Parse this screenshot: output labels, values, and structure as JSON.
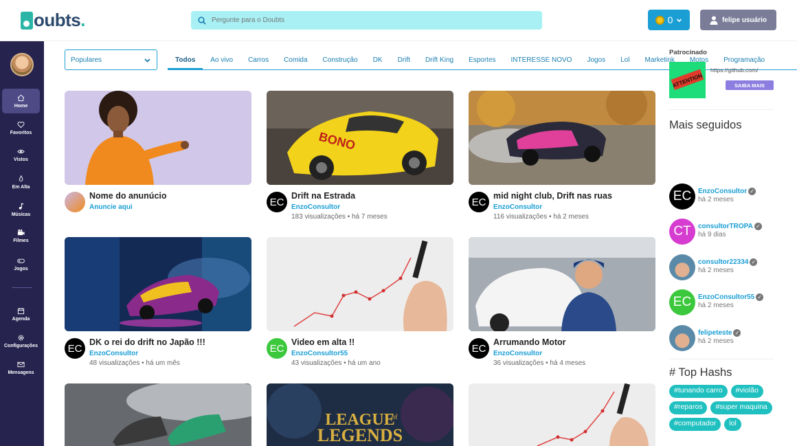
{
  "header": {
    "logo_text": "oubts",
    "logo_dot": ".",
    "search_placeholder": "Pergunte para o Doubts",
    "coins": "0",
    "user_name": "felipe usuário"
  },
  "sidebar": {
    "items": [
      {
        "label": "Home",
        "icon": "home-icon"
      },
      {
        "label": "Favoritos",
        "icon": "heart-icon"
      },
      {
        "label": "Vistos",
        "icon": "eye-icon"
      },
      {
        "label": "Em Alta",
        "icon": "flame-icon"
      },
      {
        "label": "Músicas",
        "icon": "music-icon"
      },
      {
        "label": "Filmes",
        "icon": "film-icon"
      },
      {
        "label": "Jogos",
        "icon": "gamepad-icon"
      },
      {
        "label": "Agenda",
        "icon": "calendar-icon"
      },
      {
        "label": "Configurações",
        "icon": "gear-icon"
      },
      {
        "label": "Mensagens",
        "icon": "mail-icon"
      }
    ]
  },
  "filter": {
    "selected": "Populares"
  },
  "tabs": [
    "Todos",
    "Ao vivo",
    "Carros",
    "Comida",
    "Construção",
    "DK",
    "Drift",
    "Drift King",
    "Esportes",
    "INTERESSE NOVO",
    "Jogos",
    "Lol",
    "Marketink",
    "Motos",
    "Programação"
  ],
  "videos": [
    {
      "title": "Nome do anunúcio",
      "channel": "Anuncie aqui",
      "stats": "",
      "avatar_text": ""
    },
    {
      "title": "Drift na Estrada",
      "channel": "EnzoConsultor",
      "stats": "183 visualizações • há 7 meses",
      "avatar_text": "EC"
    },
    {
      "title": "mid night club, Drift nas ruas",
      "channel": "EnzoConsultor",
      "stats": "116 visualizações • há 2 meses",
      "avatar_text": "EC"
    },
    {
      "title": "DK o rei do drift no Japão !!!",
      "channel": "EnzoConsultor",
      "stats": "48 visualizações • há um mês",
      "avatar_text": "EC"
    },
    {
      "title": "Video em alta !!",
      "channel": "EnzoConsultor55",
      "stats": "43 visualizações • há um ano",
      "avatar_text": "EC"
    },
    {
      "title": "Arrumando Motor",
      "channel": "EnzoConsultor",
      "stats": "36 visualizações • há 4 meses",
      "avatar_text": "EC"
    }
  ],
  "thumb_texts": {
    "bono": "BONO",
    "lol_line1": "LEAGUE",
    "lol_line2": "LEGENDS",
    "lol_of": "of"
  },
  "sponsored": {
    "label": "Patrocinado",
    "url": "https://github.com/",
    "button": "SAIBA MAIS",
    "img_text": "ATTENTION"
  },
  "most_followed": {
    "heading": "Mais seguidos",
    "users": [
      {
        "name": "EnzoConsultor",
        "time": "há 2 meses",
        "avatar_text": "EC",
        "color": "#000000"
      },
      {
        "name": "consultorTROPA",
        "time": "há 9 dias",
        "avatar_text": "CT",
        "color": "#d63ccf"
      },
      {
        "name": "consultor22334",
        "time": "há 2 meses",
        "avatar_text": "",
        "color": "#6aa0b8"
      },
      {
        "name": "EnzoConsultor55",
        "time": "há 2 meses",
        "avatar_text": "EC",
        "color": "#3cc83c"
      },
      {
        "name": "felipeteste",
        "time": "há 2 meses",
        "avatar_text": "",
        "color": "#6aa0b8"
      }
    ]
  },
  "top_hashs": {
    "heading": "# Top Hashs",
    "tags": [
      "#tunando carro",
      "#violão",
      "#reparos",
      "#super maquina",
      "#computador",
      "lol"
    ]
  }
}
